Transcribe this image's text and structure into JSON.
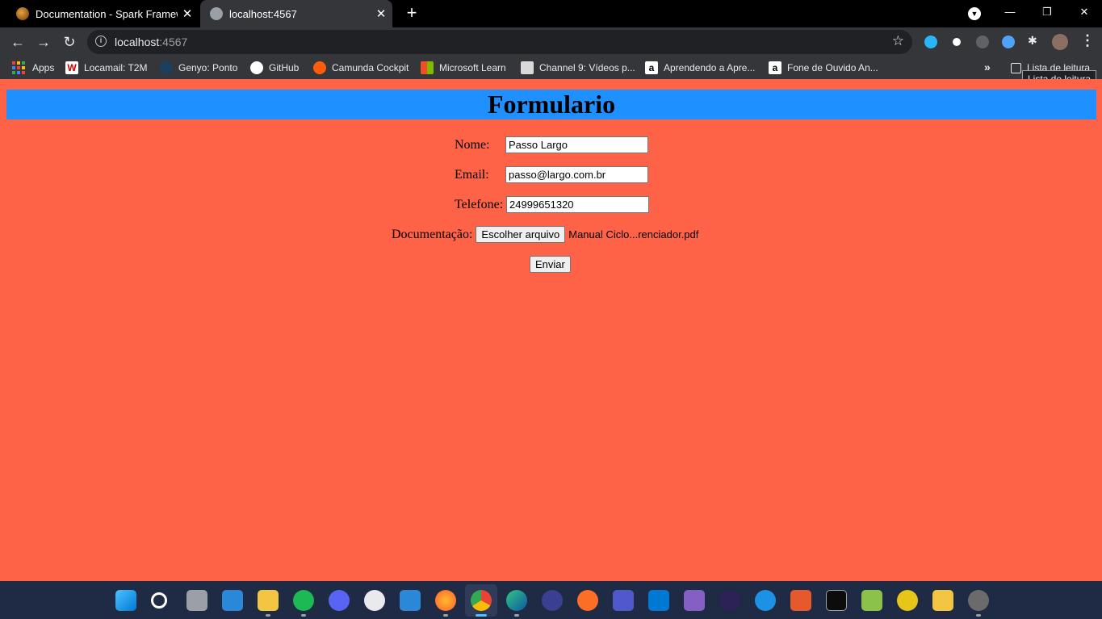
{
  "browser": {
    "tabs": [
      {
        "title": "Documentation - Spark Framewo",
        "active": false
      },
      {
        "title": "localhost:4567",
        "active": true
      }
    ],
    "address": {
      "host": "localhost",
      "port": ":4567"
    },
    "bookmarks": [
      {
        "label": "Apps",
        "icon": "apps-grid-icon"
      },
      {
        "label": "Locamail: T2M",
        "icon": "locamail-icon"
      },
      {
        "label": "Genyo: Ponto",
        "icon": "genyo-icon"
      },
      {
        "label": "GitHub",
        "icon": "github-icon"
      },
      {
        "label": "Camunda Cockpit",
        "icon": "camunda-icon"
      },
      {
        "label": "Microsoft Learn",
        "icon": "microsoft-icon"
      },
      {
        "label": "Channel 9: Vídeos p...",
        "icon": "channel9-icon"
      },
      {
        "label": "Aprendendo a Apre...",
        "icon": "amazon-icon"
      },
      {
        "label": "Fone de Ouvido An...",
        "icon": "amazon-icon"
      }
    ],
    "reading_list": {
      "label": "Lista de leitura",
      "tooltip": "Lista de leitura"
    }
  },
  "page": {
    "title": "Formulario",
    "fields": {
      "nome": {
        "label": "Nome:",
        "value": "Passo Largo"
      },
      "email": {
        "label": "Email:",
        "value": "passo@largo.com.br"
      },
      "telefone": {
        "label": "Telefone:",
        "value": "24999651320"
      },
      "documentacao": {
        "label": "Documentação:",
        "button": "Escolher arquivo",
        "filename": "Manual Ciclo...renciador.pdf"
      }
    },
    "submit": "Enviar"
  },
  "colors": {
    "page_bg": "#ff6347",
    "header_bg": "#1e90ff"
  }
}
